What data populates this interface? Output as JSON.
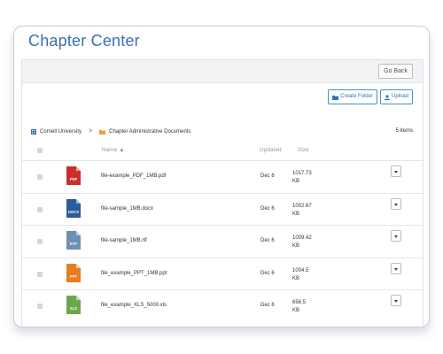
{
  "page": {
    "title": "Chapter Center"
  },
  "toolbar": {
    "go_back_label": "Go Back",
    "create_folder_label": "Create Folder",
    "upload_label": "Upload"
  },
  "breadcrumb": {
    "root": "Cornell University",
    "separator": ">",
    "current": "Chapter Administrative Documents"
  },
  "item_count": "5 items",
  "columns": {
    "name": "Name",
    "updated": "Updated",
    "size": "Size"
  },
  "files": [
    {
      "name": "file-example_PDF_1MB.pdf",
      "updated": "Dec 6",
      "size_num": "1017.73",
      "size_unit": "KB",
      "type_label": "PDF",
      "color": "#c9302c"
    },
    {
      "name": "file-sample_1MB.docx",
      "updated": "Dec 6",
      "size_num": "1002.67",
      "size_unit": "KB",
      "type_label": "DOCX",
      "color": "#2b5d9b"
    },
    {
      "name": "file-sample_1MB.rtf",
      "updated": "Dec 6",
      "size_num": "1009.42",
      "size_unit": "KB",
      "type_label": "RTF",
      "color": "#6f8fb3"
    },
    {
      "name": "file_example_PPT_1MB.ppt",
      "updated": "Dec 6",
      "size_num": "1004.5",
      "size_unit": "KB",
      "type_label": "PPT",
      "color": "#e67e22"
    },
    {
      "name": "file_example_XLS_5000.xls",
      "updated": "Dec 6",
      "size_num": "656.5",
      "size_unit": "KB",
      "type_label": "XLS",
      "color": "#6aa84f"
    }
  ],
  "colors": {
    "accent": "#3b6fb4",
    "button_blue": "#2d74bd",
    "sort": "#3a9ad9",
    "folder": "#f0a030"
  }
}
